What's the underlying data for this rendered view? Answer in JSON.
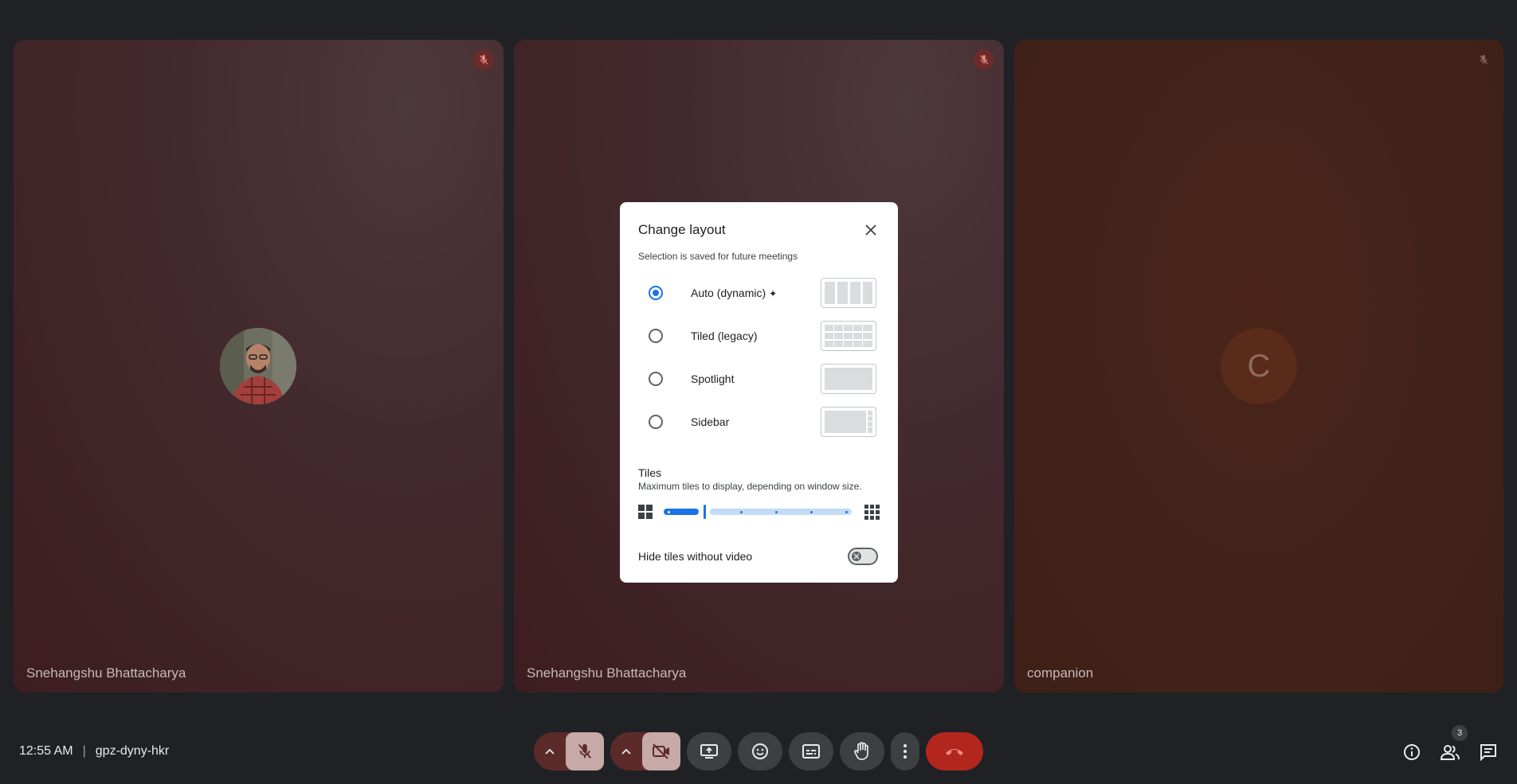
{
  "tiles": [
    {
      "name": "Snehangshu Bhattacharya",
      "muted": true
    },
    {
      "name": "Snehangshu Bhattacharya",
      "muted": true
    },
    {
      "name": "companion",
      "avatar_letter": "C",
      "muted": true
    }
  ],
  "dialog": {
    "title": "Change layout",
    "subtitle": "Selection is saved for future meetings",
    "options": [
      {
        "label": "Auto (dynamic)",
        "selected": true,
        "sparkle": "✦"
      },
      {
        "label": "Tiled (legacy)",
        "selected": false
      },
      {
        "label": "Spotlight",
        "selected": false
      },
      {
        "label": "Sidebar",
        "selected": false
      }
    ],
    "tiles_heading": "Tiles",
    "tiles_description": "Maximum tiles to display, depending on window size.",
    "hide_tiles_label": "Hide tiles without video",
    "hide_tiles_enabled": false
  },
  "meeting": {
    "time": "12:55 AM",
    "code": "gpz-dyny-hkr"
  },
  "controls": {
    "people_count": "3"
  },
  "colors": {
    "accent": "#1a73e8",
    "end_call": "#ea4335",
    "muted_red": "#f28b82"
  }
}
